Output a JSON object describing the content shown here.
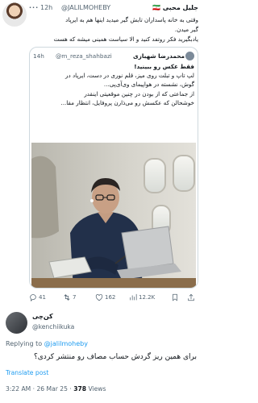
{
  "top_tweet": {
    "more_label": "···",
    "time": "12h",
    "handle": "@JALILMOHEBY",
    "name": "جلیل محبی 🇮🇷",
    "body_lines": [
      "وقتی به خانه پاسداران تابش گیر میدید اینها هم به ایرپاد",
      "گیر میدن.",
      "یادبگیرید فکر روتفد کنید و الا سیاست همینی میشه که هست"
    ]
  },
  "quote": {
    "time": "14h",
    "handle": "@m_reza_shahbazi",
    "name": "محمدرضا شهبازی",
    "body_lines": [
      "فقط عکس رو ببینید!",
      "لپ تاپ و تبلت روی میز، قلم نوری در دست، ایرپاد در",
      "گوش، نشسته در هواپیمای وی‌آی‌پی...",
      "از جماعتی که از بودن در چنین موقعیتی اینقدر",
      "خوشحالن که عکسش رو می‌ذارن پروفایل، انتظار مقا..."
    ]
  },
  "actions": {
    "replies": "41",
    "retweets": "7",
    "likes": "162",
    "views": "12.2K"
  },
  "reply": {
    "name": "کن‌چی",
    "handle": "@kenchiikuka",
    "replying_to_prefix": "Replying to",
    "replying_to_handle": "@jalilmoheby",
    "body": "برای همین ریز گردش حساب مصاف رو منتشر کردی؟",
    "translate_label": "Translate post",
    "timestamp": "3:22 AM · 26 Mar 25 · ",
    "views_count": "378",
    "views_label": " Views"
  },
  "colors": {
    "accent": "#1d9bf0",
    "secondary_text": "#536471",
    "border": "#cfd9de"
  }
}
